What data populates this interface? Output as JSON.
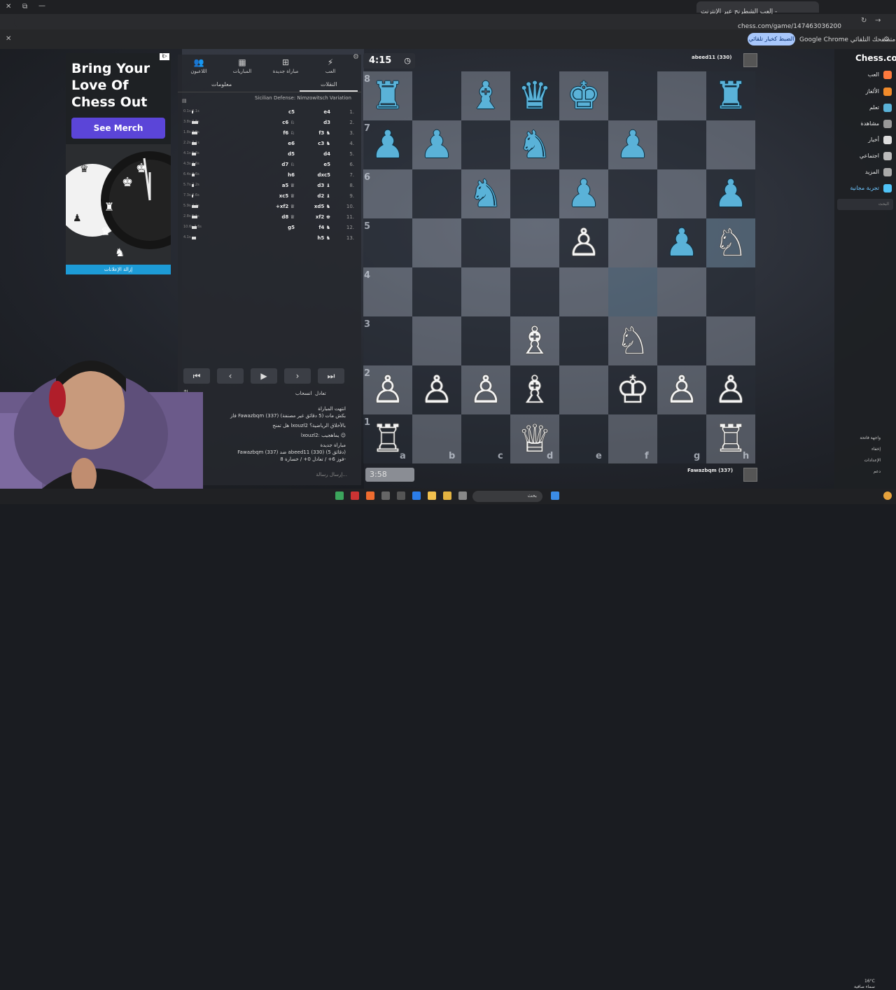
{
  "browser": {
    "tab_title": "إلعب الشطرنج عبر الإنترنت -",
    "url": "chess.com/game/147463036200",
    "infobar_text": "Google Chrome ليس متصفحك التلقائي",
    "infobar_button": "الضبط كخيار تلقائي"
  },
  "ad": {
    "title_line1": "Bring Your",
    "title_line2": "Love Of",
    "title_line3": "Chess Out",
    "button": "See Merch",
    "footer": "إزالة الإعلانات",
    "badge": "i▷"
  },
  "panel": {
    "tabs": [
      {
        "label": "العب",
        "icon": "bolt-icon"
      },
      {
        "label": "مباراة جديدة",
        "icon": "plus-icon"
      },
      {
        "label": "المباريات",
        "icon": "board-icon"
      },
      {
        "label": "اللاعبون",
        "icon": "users-icon"
      }
    ],
    "subtab_moves": "النقلات",
    "subtab_info": "معلومات",
    "opening": "Sicilian Defense: Nimzowitsch Variation",
    "moves": [
      {
        "n": "1.",
        "w": "e4",
        "b": "c5",
        "t": "0.1s 0.1s"
      },
      {
        "n": "2.",
        "w": "d3",
        "b": "c6 ♘",
        "t": "3.8s 0.8s"
      },
      {
        "n": "3.",
        "w": "f3 ♞",
        "b": "f6 ♘",
        "t": "1.8s 2.9s"
      },
      {
        "n": "4.",
        "w": "c3 ♞",
        "b": "e6",
        "t": "2.2s 3.1s"
      },
      {
        "n": "5.",
        "w": "d4",
        "b": "d5",
        "t": "4.1s 5.3s"
      },
      {
        "n": "6.",
        "w": "e5",
        "b": "d7 ♘",
        "t": "4.3s 3.6s"
      },
      {
        "n": "7.",
        "w": "dxc5",
        "b": "h6",
        "t": "6.4s 3.6s"
      },
      {
        "n": "8.",
        "w": "d3 ♝",
        "b": "a5 ♕",
        "t": "5.7s 7.2s"
      },
      {
        "n": "9.",
        "w": "d2 ♝",
        "b": "xc5 ♕",
        "t": "7.3s 3.6s"
      },
      {
        "n": "10.",
        "w": "xd5 ♞",
        "b": "+xf2 ♕",
        "t": "5.9s 4.2s"
      },
      {
        "n": "11.",
        "w": "xf2 ♚",
        "b": "d8 ♕",
        "t": "2.8s 5.1s"
      },
      {
        "n": "12.",
        "w": "f4 ♞",
        "b": "g5",
        "t": "10.6s 3.6s"
      },
      {
        "n": "13.",
        "w": "h5 ♞",
        "b": "",
        "t": "4.1s"
      }
    ],
    "controls": [
      "⏮",
      "‹",
      "▶",
      "›",
      "⏭"
    ],
    "draw_label": "تعادل",
    "resign_label": "انسحاب",
    "chat": [
      "انتهت المباراة",
      "فاز Fawazbqm (337) بكش مات (5 دقائق غير مصنفة)",
      "هل تمنح lxouzl2 بالأخلاق الرياضية؟",
      "lxouzl2: يماهجيب 😉",
      "مباراة جديدة",
      "Fawazbqm (337) ضد abeed11 (330) (5 دقائق)",
      "فوز 6+ / تعادل 0+ / خسارة 8-"
    ],
    "chat_placeholder": "إرسال رسالة..."
  },
  "game": {
    "clock_top": "4:15",
    "clock_bottom": "3:58",
    "top_player": "abeed11 (330)",
    "bottom_player": "Fawazbqm (337)",
    "files": [
      "a",
      "b",
      "c",
      "d",
      "e",
      "f",
      "g",
      "h"
    ],
    "ranks": [
      "8",
      "7",
      "6",
      "5",
      "4",
      "3",
      "2",
      "1"
    ],
    "pieces": [
      {
        "sq": "a8",
        "p": "♜",
        "c": "b"
      },
      {
        "sq": "c8",
        "p": "♝",
        "c": "b"
      },
      {
        "sq": "d8",
        "p": "♛",
        "c": "b"
      },
      {
        "sq": "e8",
        "p": "♚",
        "c": "b"
      },
      {
        "sq": "h8",
        "p": "♜",
        "c": "b"
      },
      {
        "sq": "a7",
        "p": "♟",
        "c": "b"
      },
      {
        "sq": "b7",
        "p": "♟",
        "c": "b"
      },
      {
        "sq": "d7",
        "p": "♞",
        "c": "b"
      },
      {
        "sq": "f7",
        "p": "♟",
        "c": "b"
      },
      {
        "sq": "c6",
        "p": "♞",
        "c": "b"
      },
      {
        "sq": "e6",
        "p": "♟",
        "c": "b"
      },
      {
        "sq": "h6",
        "p": "♟",
        "c": "b"
      },
      {
        "sq": "e5",
        "p": "♙",
        "c": "w"
      },
      {
        "sq": "g5",
        "p": "♟",
        "c": "b"
      },
      {
        "sq": "h5",
        "p": "♘",
        "c": "w"
      },
      {
        "sq": "d3",
        "p": "♗",
        "c": "w"
      },
      {
        "sq": "f3",
        "p": "♘",
        "c": "w"
      },
      {
        "sq": "a2",
        "p": "♙",
        "c": "w"
      },
      {
        "sq": "b2",
        "p": "♙",
        "c": "w"
      },
      {
        "sq": "c2",
        "p": "♙",
        "c": "w"
      },
      {
        "sq": "d2",
        "p": "♗",
        "c": "w"
      },
      {
        "sq": "f2",
        "p": "♔",
        "c": "w"
      },
      {
        "sq": "g2",
        "p": "♙",
        "c": "w"
      },
      {
        "sq": "h2",
        "p": "♙",
        "c": "w"
      },
      {
        "sq": "a1",
        "p": "♖",
        "c": "w"
      },
      {
        "sq": "d1",
        "p": "♕",
        "c": "w"
      },
      {
        "sq": "h1",
        "p": "♖",
        "c": "w"
      }
    ],
    "highlight": [
      "h5",
      "f4"
    ]
  },
  "nav": {
    "logo": "Chess.com",
    "items": [
      "العب",
      "الألغاز",
      "تعلم",
      "مشاهدة",
      "أخبار",
      "اجتماعي",
      "المزيد",
      "تجربة مجانية"
    ],
    "search_placeholder": "البحث",
    "bottom": [
      "واجهة فاتحة",
      "إخفاء",
      "الإعدادات",
      "دعم"
    ]
  },
  "taskbar": {
    "search": "بحث",
    "weather": "16°C",
    "weather_desc": "سماء صافية"
  }
}
